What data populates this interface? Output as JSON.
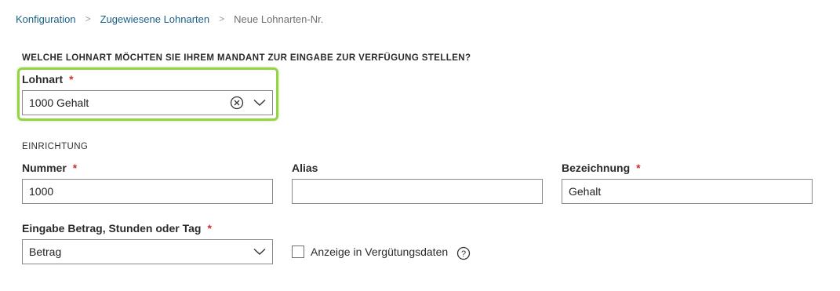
{
  "breadcrumb": {
    "items": [
      "Konfiguration",
      "Zugewiesene Lohnarten",
      "Neue Lohnarten-Nr."
    ]
  },
  "lohnart_section": {
    "question": "WELCHE LOHNART MÖCHTEN SIE IHREM MANDANT ZUR EINGABE ZUR VERFÜGUNG STELLEN?",
    "label": "Lohnart",
    "required_mark": "*",
    "value": "1000 Gehalt"
  },
  "einrichtung": {
    "title": "EINRICHTUNG",
    "nummer": {
      "label": "Nummer",
      "required_mark": "*",
      "value": "1000"
    },
    "alias": {
      "label": "Alias",
      "value": ""
    },
    "bezeichnung": {
      "label": "Bezeichnung",
      "required_mark": "*",
      "value": "Gehalt"
    },
    "eingabe": {
      "label": "Eingabe Betrag, Stunden oder Tag",
      "required_mark": "*",
      "value": "Betrag"
    },
    "anzeige": {
      "label": "Anzeige in Vergütungsdaten",
      "checked": false
    }
  },
  "colors": {
    "link": "#1a5f86",
    "required": "#d0312d",
    "highlight": "#94d346",
    "border": "#8a8a8a"
  },
  "icons": [
    "chevron-right-icon",
    "clear-circle-icon",
    "chevron-down-icon",
    "help-circle-icon"
  ]
}
